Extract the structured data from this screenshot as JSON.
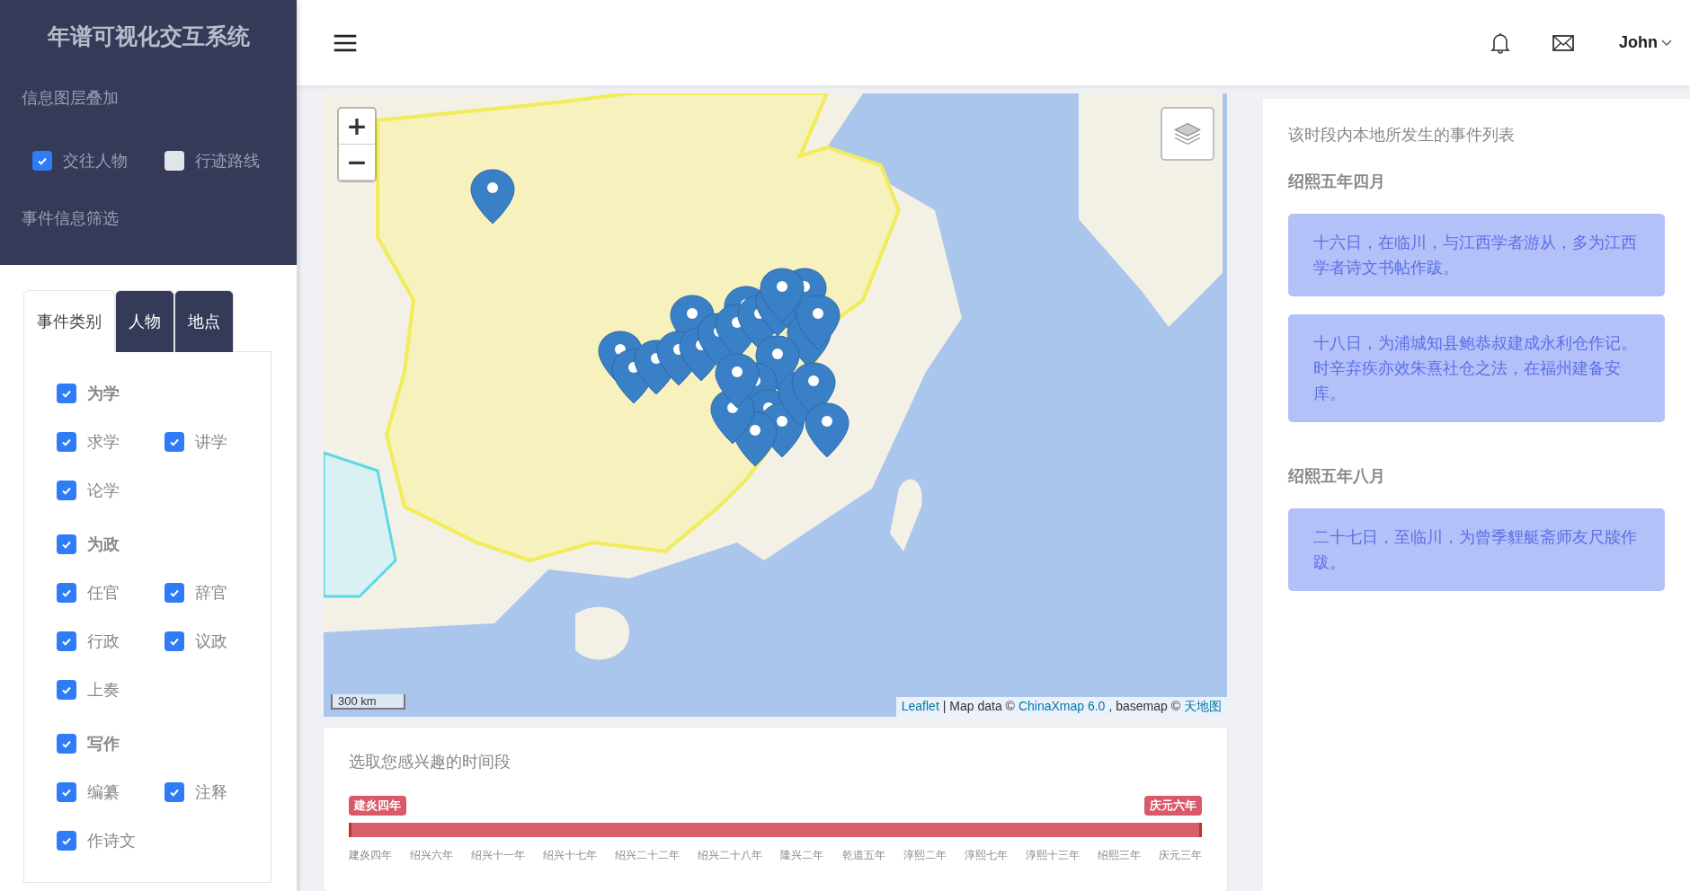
{
  "sidebar": {
    "title": "年谱可视化交互系统",
    "layer_heading": "信息图层叠加",
    "layers": [
      {
        "label": "交往人物",
        "checked": true
      },
      {
        "label": "行迹路线",
        "checked": false
      }
    ],
    "filter_heading": "事件信息筛选",
    "tabs": [
      {
        "label": "事件类别",
        "selected": true
      },
      {
        "label": "人物",
        "selected": false
      },
      {
        "label": "地点",
        "selected": false
      }
    ],
    "categories": [
      {
        "label": "为学",
        "checked": true,
        "children": [
          {
            "label": "求学",
            "checked": true
          },
          {
            "label": "讲学",
            "checked": true
          },
          {
            "label": "论学",
            "checked": true
          }
        ]
      },
      {
        "label": "为政",
        "checked": true,
        "children": [
          {
            "label": "任官",
            "checked": true
          },
          {
            "label": "辞官",
            "checked": true
          },
          {
            "label": "行政",
            "checked": true
          },
          {
            "label": "议政",
            "checked": true
          },
          {
            "label": "上奏",
            "checked": true
          }
        ]
      },
      {
        "label": "写作",
        "checked": true,
        "children": [
          {
            "label": "编纂",
            "checked": true
          },
          {
            "label": "注释",
            "checked": true
          },
          {
            "label": "作诗文",
            "checked": true
          }
        ]
      }
    ]
  },
  "header": {
    "user": "John"
  },
  "map": {
    "zoom_in": "+",
    "zoom_out": "−",
    "scale": "300 km",
    "attribution": [
      {
        "text": "Leaflet",
        "kind": "link"
      },
      {
        "text": "| Map data ©",
        "kind": "text"
      },
      {
        "text": "ChinaXmap 6.0",
        "kind": "link"
      },
      {
        "text": ", basemap ©",
        "kind": "text"
      },
      {
        "text": "天地图",
        "kind": "link"
      }
    ]
  },
  "timeline": {
    "title": "选取您感兴趣的时间段",
    "start_label": "建炎四年",
    "end_label": "庆元六年",
    "level": 1,
    "ticks": [
      "建炎四年",
      "绍兴六年",
      "绍兴十一年",
      "绍兴十七年",
      "绍兴二十二年",
      "绍兴二十八年",
      "隆兴二年",
      "乾道五年",
      "淳熙二年",
      "淳熙七年",
      "淳熙十三年",
      "绍熙三年",
      "庆元三年"
    ]
  },
  "events": {
    "heading": "该时段内本地所发生的事件列表",
    "groups": [
      {
        "date": "绍熙五年四月",
        "items": [
          "十六日，在临川，与江西学者游从，多为江西学者诗文书帖作跋。",
          "十八日，为浦城知县鲍恭叔建成永利仓作记。时辛弃疾亦效朱熹社仓之法，在福州建备安库。"
        ]
      },
      {
        "date": "绍熙五年八月",
        "items": [
          "二十七日，至临川，为曾季貍艇斋师友尺牍作跋。"
        ]
      }
    ]
  }
}
